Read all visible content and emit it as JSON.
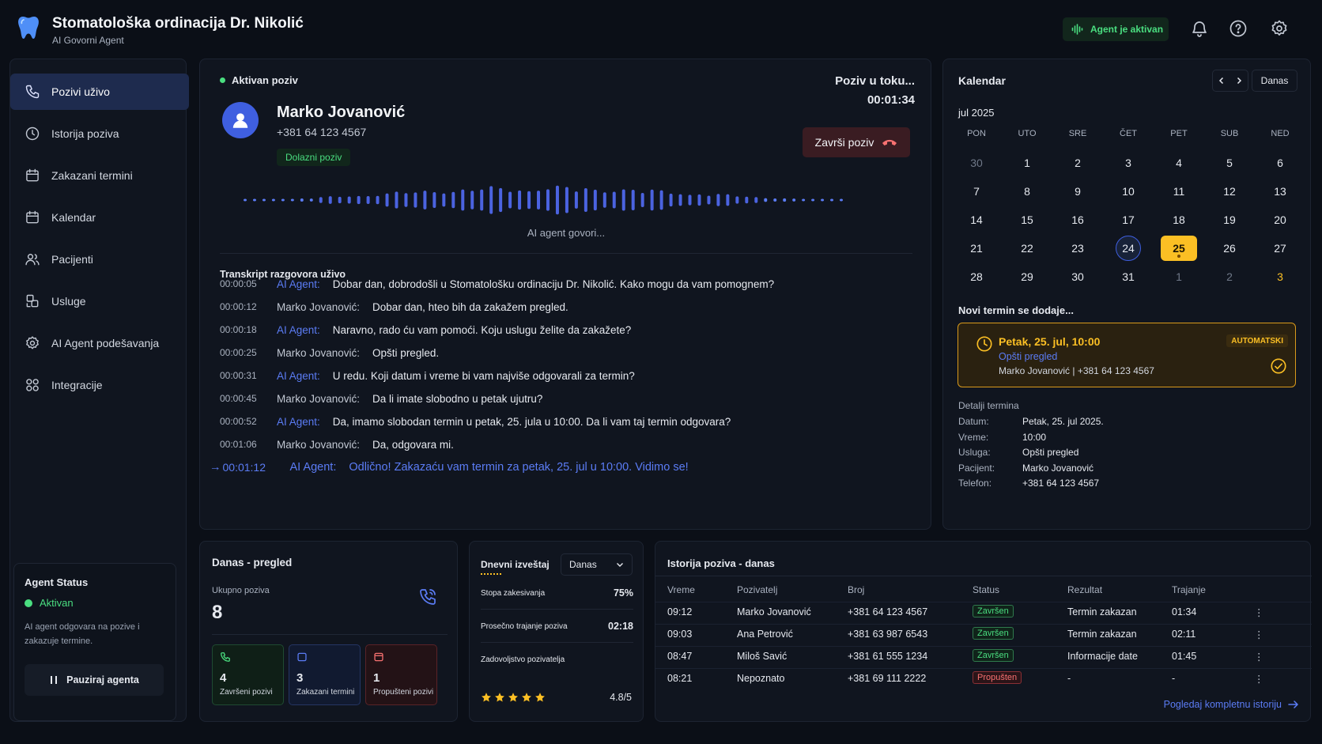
{
  "header": {
    "title": "Stomatološka ordinacija Dr. Nikolić",
    "subtitle": "AI Govorni Agent",
    "agent_pill": "Agent je aktivan"
  },
  "sidebar": {
    "items": [
      {
        "label": "Pozivi uživo",
        "icon": "phone-icon"
      },
      {
        "label": "Istorija poziva",
        "icon": "clock-icon"
      },
      {
        "label": "Zakazani termini",
        "icon": "calendar-icon"
      },
      {
        "label": "Kalendar",
        "icon": "calendar-icon"
      },
      {
        "label": "Pacijenti",
        "icon": "users-icon"
      },
      {
        "label": "Usluge",
        "icon": "services-icon"
      },
      {
        "label": "AI Agent podešavanja",
        "icon": "gear-icon"
      },
      {
        "label": "Integracije",
        "icon": "grid-icon"
      }
    ],
    "agent_status": {
      "title": "Agent Status",
      "state": "Aktivan",
      "description": "AI agent odgovara na pozive i zakazuje termine.",
      "pause_label": "Pauziraj agenta"
    }
  },
  "call": {
    "state_label": "Aktivan poziv",
    "caller_name": "Marko Jovanović",
    "caller_phone": "+381 64 123 4567",
    "call_type": "Dolazni poziv",
    "progress_label": "Poziv u toku...",
    "timer": "00:01:34",
    "end_label": "Završi poziv",
    "speaking_label": "AI agent govori...",
    "transcript_title": "Transkript razgovora uživo",
    "transcript": [
      {
        "time": "00:00:05",
        "speaker": "AI Agent:",
        "ai": true,
        "text": "Dobar dan, dobrodošli u Stomatološku ordinaciju Dr. Nikolić. Kako mogu da vam pomognem?"
      },
      {
        "time": "00:00:12",
        "speaker": "Marko Jovanović:",
        "ai": false,
        "text": "Dobar dan, hteo bih da zakažem pregled."
      },
      {
        "time": "00:00:18",
        "speaker": "AI Agent:",
        "ai": true,
        "text": "Naravno, rado ću vam pomoći. Koju uslugu želite da zakažete?"
      },
      {
        "time": "00:00:25",
        "speaker": "Marko Jovanović:",
        "ai": false,
        "text": "Opšti pregled."
      },
      {
        "time": "00:00:31",
        "speaker": "AI Agent:",
        "ai": true,
        "text": "U redu. Koji datum i vreme bi vam najviše odgovarali za termin?"
      },
      {
        "time": "00:00:45",
        "speaker": "Marko Jovanović:",
        "ai": false,
        "text": "Da li imate slobodno u petak ujutru?"
      },
      {
        "time": "00:00:52",
        "speaker": "AI Agent:",
        "ai": true,
        "text": "Da, imamo slobodan termin u petak, 25. jula u 10:00. Da li vam taj termin odgovara?"
      },
      {
        "time": "00:01:06",
        "speaker": "Marko Jovanović:",
        "ai": false,
        "text": "Da, odgovara mi."
      },
      {
        "time": "00:01:12",
        "speaker": "AI Agent:",
        "ai": true,
        "current": true,
        "text": "Odlično! Zakazaću vam termin za petak, 25. jul u 10:00. Vidimo se!"
      }
    ]
  },
  "calendar": {
    "title": "Kalendar",
    "today_label": "Danas",
    "month": "jul 2025",
    "weekdays": [
      "PON",
      "UTO",
      "SRE",
      "ČET",
      "PET",
      "SUB",
      "NED"
    ],
    "weeks": [
      [
        "30",
        "1",
        "2",
        "3",
        "4",
        "5",
        "6"
      ],
      [
        "7",
        "8",
        "9",
        "10",
        "11",
        "12",
        "13"
      ],
      [
        "14",
        "15",
        "16",
        "17",
        "18",
        "19",
        "20"
      ],
      [
        "21",
        "22",
        "23",
        "24",
        "25",
        "26",
        "27"
      ],
      [
        "28",
        "29",
        "30",
        "31",
        "1",
        "2",
        "3"
      ]
    ],
    "today_day": "24",
    "selected_day": "25",
    "new_label": "Novi termin se dodaje...",
    "new_card": {
      "when": "Petak, 25. jul, 10:00",
      "service": "Opšti pregled",
      "who": "Marko Jovanović | +381 64 123 4567",
      "badge": "AUTOMATSKI"
    },
    "details_title": "Detalji termina",
    "details": [
      {
        "k": "Datum:",
        "v": "Petak, 25. jul 2025."
      },
      {
        "k": "Vreme:",
        "v": "10:00"
      },
      {
        "k": "Usluga:",
        "v": "Opšti pregled"
      },
      {
        "k": "Pacijent:",
        "v": "Marko Jovanović"
      },
      {
        "k": "Telefon:",
        "v": "+381 64 123 4567"
      }
    ]
  },
  "overview": {
    "title": "Danas - pregled",
    "total_label": "Ukupno poziva",
    "total": "8",
    "cards": [
      {
        "num": "4",
        "label": "Završeni pozivi",
        "color": "#4ade80"
      },
      {
        "num": "3",
        "label": "Zakazani termini",
        "color": "#5b7cf5"
      },
      {
        "num": "1",
        "label": "Propušteni pozivi",
        "color": "#f87171"
      }
    ]
  },
  "daily": {
    "title": "Dnevni izveštaj",
    "period": "Danas",
    "rows": [
      {
        "label": "Stopa zakesivanja",
        "value": "75%"
      },
      {
        "label": "Prosečno trajanje poziva",
        "value": "02:18"
      }
    ],
    "satisfaction_label": "Zadovoljstvo pozivatelja",
    "stars": 5,
    "rating": "4.8/5"
  },
  "history": {
    "title": "Istorija poziva - danas",
    "columns": [
      "Vreme",
      "Pozivatelj",
      "Broj",
      "Status",
      "Rezultat",
      "Trajanje"
    ],
    "rows": [
      {
        "time": "09:12",
        "caller": "Marko Jovanović",
        "number": "+381 64 123 4567",
        "status": "Završen",
        "ok": true,
        "result": "Termin zakazan",
        "duration": "01:34"
      },
      {
        "time": "09:03",
        "caller": "Ana Petrović",
        "number": "+381 63 987 6543",
        "status": "Završen",
        "ok": true,
        "result": "Termin zakazan",
        "duration": "02:11"
      },
      {
        "time": "08:47",
        "caller": "Miloš Savić",
        "number": "+381 61 555 1234",
        "status": "Završen",
        "ok": true,
        "result": "Informacije date",
        "duration": "01:45"
      },
      {
        "time": "08:21",
        "caller": "Nepoznato",
        "number": "+381 69 111 2222",
        "status": "Propušten",
        "ok": false,
        "result": "-",
        "duration": "-"
      }
    ],
    "link_label": "Pogledaj kompletnu istoriju"
  },
  "colors": {
    "accent": "#3f5fe0",
    "success": "#4ade80",
    "warning": "#fbbf24",
    "danger": "#f87171"
  }
}
